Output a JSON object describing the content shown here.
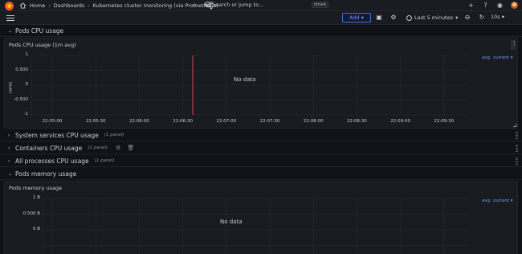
{
  "topbar": {
    "breadcrumbs": [
      "Home",
      "Dashboards",
      "Kubernetes cluster monitoring (via Prometheus)"
    ],
    "search_placeholder": "Search or jump to...",
    "search_shortcut": "ctrl+k"
  },
  "toolbar": {
    "add_label": "Add",
    "time_range": "Last 5 minutes",
    "refresh_interval": "10s"
  },
  "rows": [
    {
      "title": "Pods CPU usage",
      "collapsed": false
    },
    {
      "title": "System services CPU usage",
      "collapsed": true,
      "count": "(1 panel)"
    },
    {
      "title": "Containers CPU usage",
      "collapsed": true,
      "count": "(1 panel)"
    },
    {
      "title": "All processes CPU usage",
      "collapsed": true,
      "count": "(1 panel)"
    },
    {
      "title": "Pods memory usage",
      "collapsed": false
    }
  ],
  "panels": [
    {
      "title": "Pods CPU usage (1m avg)",
      "no_data": "No data",
      "y_axis_title": "cores",
      "y_ticks": [
        "1",
        "0.500",
        "0",
        "-0.500",
        "-1"
      ],
      "x_ticks": [
        "22:05:00",
        "22:05:30",
        "22:06:00",
        "22:06:30",
        "22:07:00",
        "22:07:30",
        "22:08:00",
        "22:08:30",
        "22:09:00",
        "22:09:30"
      ],
      "legend": [
        "avg",
        "current"
      ]
    },
    {
      "title": "Pods memory usage",
      "no_data": "No data",
      "y_ticks": [
        "1 B",
        "0.500 B",
        "0 B"
      ],
      "legend": [
        "avg",
        "current"
      ]
    }
  ],
  "colors": {
    "background": "#111217",
    "panel": "#181b1f",
    "accent": "#6e9fff",
    "annotation": "#f2495c"
  }
}
